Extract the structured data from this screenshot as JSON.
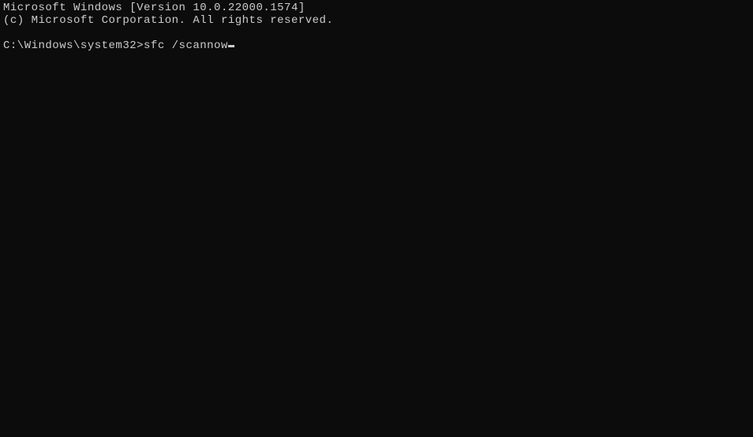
{
  "terminal": {
    "version_line": "Microsoft Windows [Version 10.0.22000.1574]",
    "copyright_line": "(c) Microsoft Corporation. All rights reserved.",
    "prompt": "C:\\Windows\\system32>",
    "command": "sfc /scannow"
  }
}
